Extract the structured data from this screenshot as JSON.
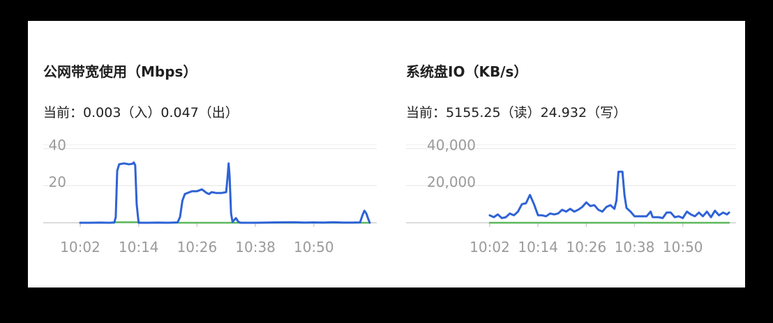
{
  "chart_data": [
    {
      "type": "line",
      "title": "公网带宽使用（Mbps）",
      "current_prefix": "当前：",
      "current_text": "0.003（入）0.047（出）",
      "xlabel": "",
      "ylabel": "",
      "x_ticks": [
        "10:02",
        "10:14",
        "10:26",
        "10:38",
        "10:50"
      ],
      "x_tick_minutes": [
        0,
        12,
        24,
        36,
        48
      ],
      "y_ticks": [
        "40",
        "20"
      ],
      "y_tick_values": [
        40,
        20
      ],
      "ylim": [
        0,
        42
      ],
      "xlim_minutes": [
        0,
        59.5
      ],
      "grid": true,
      "series": [
        {
          "name": "",
          "color": "#2e62d6",
          "points": [
            [
              0,
              0
            ],
            [
              2,
              0
            ],
            [
              4,
              0.1
            ],
            [
              6,
              0
            ],
            [
              7,
              0.1
            ],
            [
              7.3,
              3
            ],
            [
              7.6,
              28
            ],
            [
              8,
              31.5
            ],
            [
              9,
              32
            ],
            [
              10,
              31.5
            ],
            [
              10.8,
              31.8
            ],
            [
              11,
              32.5
            ],
            [
              11.3,
              31
            ],
            [
              11.6,
              10
            ],
            [
              12,
              0
            ],
            [
              14,
              0
            ],
            [
              16,
              0.1
            ],
            [
              18,
              0
            ],
            [
              20,
              0.2
            ],
            [
              20.5,
              3
            ],
            [
              21,
              12
            ],
            [
              21.5,
              15.5
            ],
            [
              22.5,
              16.5
            ],
            [
              23,
              17
            ],
            [
              24,
              17
            ],
            [
              25,
              18
            ],
            [
              25.5,
              17
            ],
            [
              26,
              16
            ],
            [
              26.5,
              15.5
            ],
            [
              27,
              16.5
            ],
            [
              28,
              16
            ],
            [
              29,
              16
            ],
            [
              30,
              16.5
            ],
            [
              30.3,
              25
            ],
            [
              30.5,
              32
            ],
            [
              30.7,
              25
            ],
            [
              31,
              5
            ],
            [
              31.3,
              0.5
            ],
            [
              32,
              2.5
            ],
            [
              32.5,
              0.5
            ],
            [
              33,
              0
            ],
            [
              36,
              0
            ],
            [
              40,
              0.2
            ],
            [
              44,
              0.3
            ],
            [
              46,
              0.1
            ],
            [
              48,
              0.2
            ],
            [
              50,
              0.1
            ],
            [
              52,
              0.3
            ],
            [
              54,
              0.1
            ],
            [
              56,
              0.1
            ],
            [
              57.5,
              0.2
            ],
            [
              58,
              4
            ],
            [
              58.4,
              6.5
            ],
            [
              58.8,
              5
            ],
            [
              59.2,
              2
            ],
            [
              59.5,
              0
            ]
          ]
        },
        {
          "name": "",
          "color": "#5cb85c",
          "points": [
            [
              0,
              0
            ],
            [
              6,
              0
            ],
            [
              7,
              0.3
            ],
            [
              12,
              0.3
            ],
            [
              13,
              0
            ],
            [
              59.5,
              0
            ]
          ]
        }
      ]
    },
    {
      "type": "line",
      "title": "系统盘IO（KB/s）",
      "current_prefix": "当前：",
      "current_text": "5155.25（读）24.932（写）",
      "xlabel": "",
      "ylabel": "",
      "x_ticks": [
        "10:02",
        "10:14",
        "10:26",
        "10:38",
        "10:50"
      ],
      "x_tick_minutes": [
        0,
        12,
        24,
        36,
        48
      ],
      "y_ticks": [
        "40,000",
        "20,000"
      ],
      "y_tick_values": [
        40000,
        20000
      ],
      "ylim": [
        0,
        42000
      ],
      "xlim_minutes": [
        0,
        59.5
      ],
      "grid": true,
      "series": [
        {
          "name": "",
          "color": "#2e62d6",
          "points": [
            [
              0,
              4000
            ],
            [
              1,
              3000
            ],
            [
              2,
              4500
            ],
            [
              3,
              2500
            ],
            [
              4,
              3000
            ],
            [
              5,
              5000
            ],
            [
              6,
              4000
            ],
            [
              7,
              6000
            ],
            [
              8,
              10000
            ],
            [
              9,
              10500
            ],
            [
              10,
              15000
            ],
            [
              11,
              10000
            ],
            [
              12,
              4000
            ],
            [
              13,
              4000
            ],
            [
              14,
              3500
            ],
            [
              15,
              5000
            ],
            [
              16,
              4500
            ],
            [
              17,
              5000
            ],
            [
              18,
              7000
            ],
            [
              19,
              6000
            ],
            [
              20,
              7500
            ],
            [
              21,
              6000
            ],
            [
              22,
              7000
            ],
            [
              23,
              8500
            ],
            [
              24,
              11000
            ],
            [
              25,
              9000
            ],
            [
              26,
              9500
            ],
            [
              27,
              7000
            ],
            [
              28,
              6000
            ],
            [
              29,
              8500
            ],
            [
              30,
              9500
            ],
            [
              31,
              7500
            ],
            [
              31.5,
              12000
            ],
            [
              32,
              27500
            ],
            [
              33,
              27500
            ],
            [
              33.5,
              15000
            ],
            [
              34,
              8000
            ],
            [
              35,
              6000
            ],
            [
              36,
              3500
            ],
            [
              38,
              3500
            ],
            [
              39,
              3500
            ],
            [
              40,
              6000
            ],
            [
              40.5,
              3000
            ],
            [
              42,
              3000
            ],
            [
              43,
              2500
            ],
            [
              44,
              5500
            ],
            [
              45,
              5500
            ],
            [
              46,
              3000
            ],
            [
              47,
              3500
            ],
            [
              48,
              2500
            ],
            [
              49,
              6000
            ],
            [
              50,
              4500
            ],
            [
              51,
              3500
            ],
            [
              52,
              5500
            ],
            [
              53,
              3500
            ],
            [
              54,
              6000
            ],
            [
              55,
              3000
            ],
            [
              56,
              6500
            ],
            [
              57,
              4000
            ],
            [
              58,
              5500
            ],
            [
              59,
              4500
            ],
            [
              59.5,
              5500
            ]
          ]
        },
        {
          "name": "",
          "color": "#5cb85c",
          "points": [
            [
              0,
              0
            ],
            [
              59.5,
              0
            ]
          ]
        }
      ]
    }
  ]
}
